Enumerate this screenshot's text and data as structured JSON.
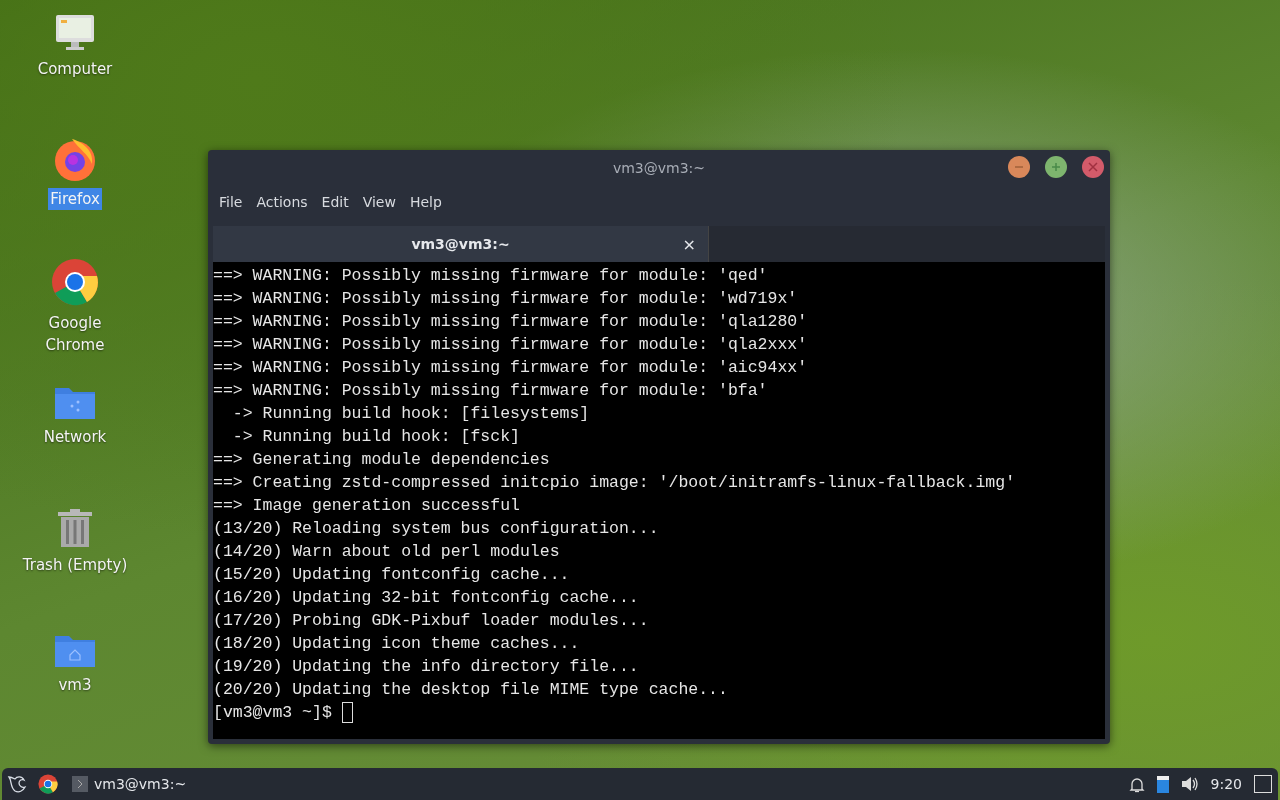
{
  "desktop_icons": [
    {
      "kind": "computer",
      "label": "Computer",
      "selected": false
    },
    {
      "kind": "firefox",
      "label": "Firefox",
      "selected": true
    },
    {
      "kind": "chrome",
      "label": "Google Chrome",
      "selected": false
    },
    {
      "kind": "network",
      "label": "Network",
      "selected": false
    },
    {
      "kind": "trash",
      "label": "Trash (Empty)",
      "selected": false
    },
    {
      "kind": "home",
      "label": "vm3",
      "selected": false
    }
  ],
  "window": {
    "title": "vm3@vm3:~",
    "menu": [
      "File",
      "Actions",
      "Edit",
      "View",
      "Help"
    ],
    "tabs": [
      {
        "label": "vm3@vm3:~",
        "selected": true,
        "close": "×"
      }
    ],
    "lines": [
      "==> WARNING: Possibly missing firmware for module: 'qed'",
      "==> WARNING: Possibly missing firmware for module: 'wd719x'",
      "==> WARNING: Possibly missing firmware for module: 'qla1280'",
      "==> WARNING: Possibly missing firmware for module: 'qla2xxx'",
      "==> WARNING: Possibly missing firmware for module: 'aic94xx'",
      "==> WARNING: Possibly missing firmware for module: 'bfa'",
      "  -> Running build hook: [filesystems]",
      "  -> Running build hook: [fsck]",
      "==> Generating module dependencies",
      "==> Creating zstd-compressed initcpio image: '/boot/initramfs-linux-fallback.img'",
      "==> Image generation successful",
      "(13/20) Reloading system bus configuration...",
      "(14/20) Warn about old perl modules",
      "(15/20) Updating fontconfig cache...",
      "(16/20) Updating 32-bit fontconfig cache...",
      "(17/20) Probing GDK-Pixbuf loader modules...",
      "(18/20) Updating icon theme caches...",
      "(19/20) Updating the info directory file...",
      "(20/20) Updating the desktop file MIME type cache..."
    ],
    "prompt": "[vm3@vm3 ~]$ "
  },
  "taskbar": {
    "tasks": [
      {
        "label": "vm3@vm3:~",
        "selected": false
      }
    ],
    "clock": "9:20"
  }
}
